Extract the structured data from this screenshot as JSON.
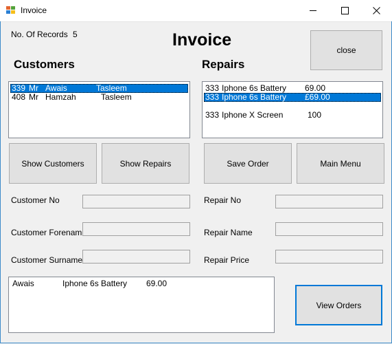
{
  "window": {
    "title": "Invoice"
  },
  "header": {
    "records_label": "No. Of Records",
    "records_count": "5",
    "main_title": "Invoice",
    "close_label": "close"
  },
  "customers": {
    "heading": "Customers",
    "rows": [
      {
        "no": "339",
        "title": "Mr",
        "forename": "Awais",
        "surname": "Tasleem",
        "selected": true
      },
      {
        "no": "408",
        "title": "Mr",
        "forename": "Hamzah",
        "surname": "Tasleem",
        "selected": false
      }
    ]
  },
  "repairs": {
    "heading": "Repairs",
    "rows": [
      {
        "no": "333",
        "name": "Iphone 6s Battery",
        "price": "69.00",
        "selected": false
      },
      {
        "no": "333",
        "name": "Iphone 6s Battery",
        "price": "£69.00",
        "selected": true
      },
      {
        "no": "",
        "name": "",
        "price": "",
        "selected": false
      },
      {
        "no": "333",
        "name": "Iphone X Screen",
        "price": "100",
        "selected": false
      }
    ]
  },
  "buttons": {
    "show_customers": "Show Customers",
    "show_repairs": "Show Repairs",
    "save_order": "Save Order",
    "main_menu": "Main Menu",
    "view_orders": "View Orders"
  },
  "form": {
    "customer_no_label": "Customer No",
    "customer_forename_label": "Customer Forename",
    "customer_surname_label": "Customer Surname",
    "repair_no_label": "Repair No",
    "repair_name_label": "Repair Name",
    "repair_price_label": "Repair Price",
    "customer_no_value": "",
    "customer_forename_value": "",
    "customer_surname_value": "",
    "repair_no_value": "",
    "repair_name_value": "",
    "repair_price_value": ""
  },
  "orders": {
    "rows": [
      {
        "customer": "Awais",
        "repair": "Iphone 6s Battery",
        "price": "69.00"
      }
    ]
  },
  "colors": {
    "selection": "#0078d7",
    "window_border": "#3c8ac9",
    "button_face": "#e1e1e1"
  },
  "icons": {
    "app": "app-window-icon",
    "minimize": "minimize-icon",
    "maximize": "maximize-icon",
    "close": "close-icon"
  }
}
